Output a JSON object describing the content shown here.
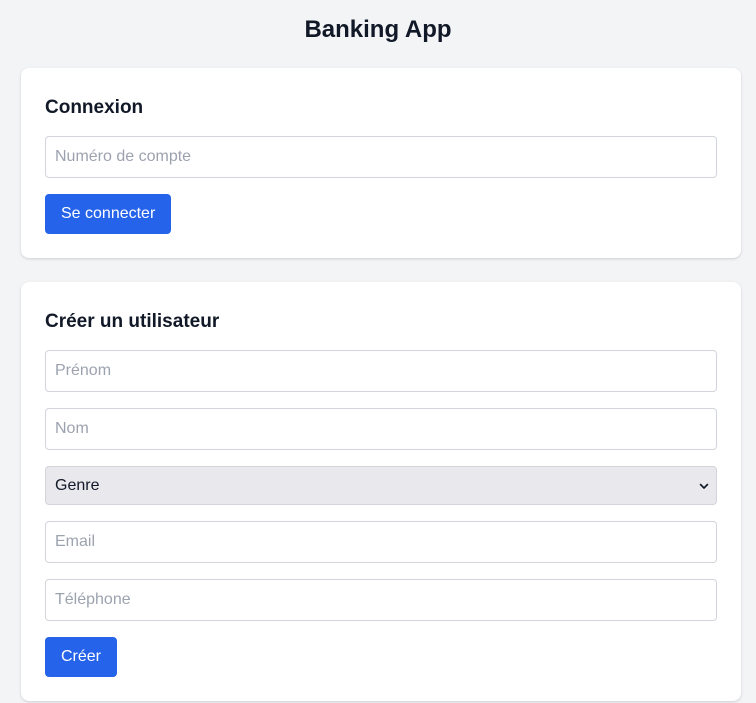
{
  "app": {
    "title": "Banking App"
  },
  "login": {
    "title": "Connexion",
    "account_number": {
      "placeholder": "Numéro de compte",
      "value": ""
    },
    "submit_label": "Se connecter"
  },
  "create_user": {
    "title": "Créer un utilisateur",
    "first_name": {
      "placeholder": "Prénom",
      "value": ""
    },
    "last_name": {
      "placeholder": "Nom",
      "value": ""
    },
    "gender": {
      "selected": "Genre",
      "icon": "chevron-down-icon"
    },
    "email": {
      "placeholder": "Email",
      "value": ""
    },
    "phone": {
      "placeholder": "Téléphone",
      "value": ""
    },
    "submit_label": "Créer"
  },
  "colors": {
    "background": "#f3f4f6",
    "card": "#ffffff",
    "primary": "#2563eb",
    "select_background": "#e9e9ed",
    "border": "#d1d5db",
    "placeholder": "#9ca3af",
    "text": "#111827"
  }
}
